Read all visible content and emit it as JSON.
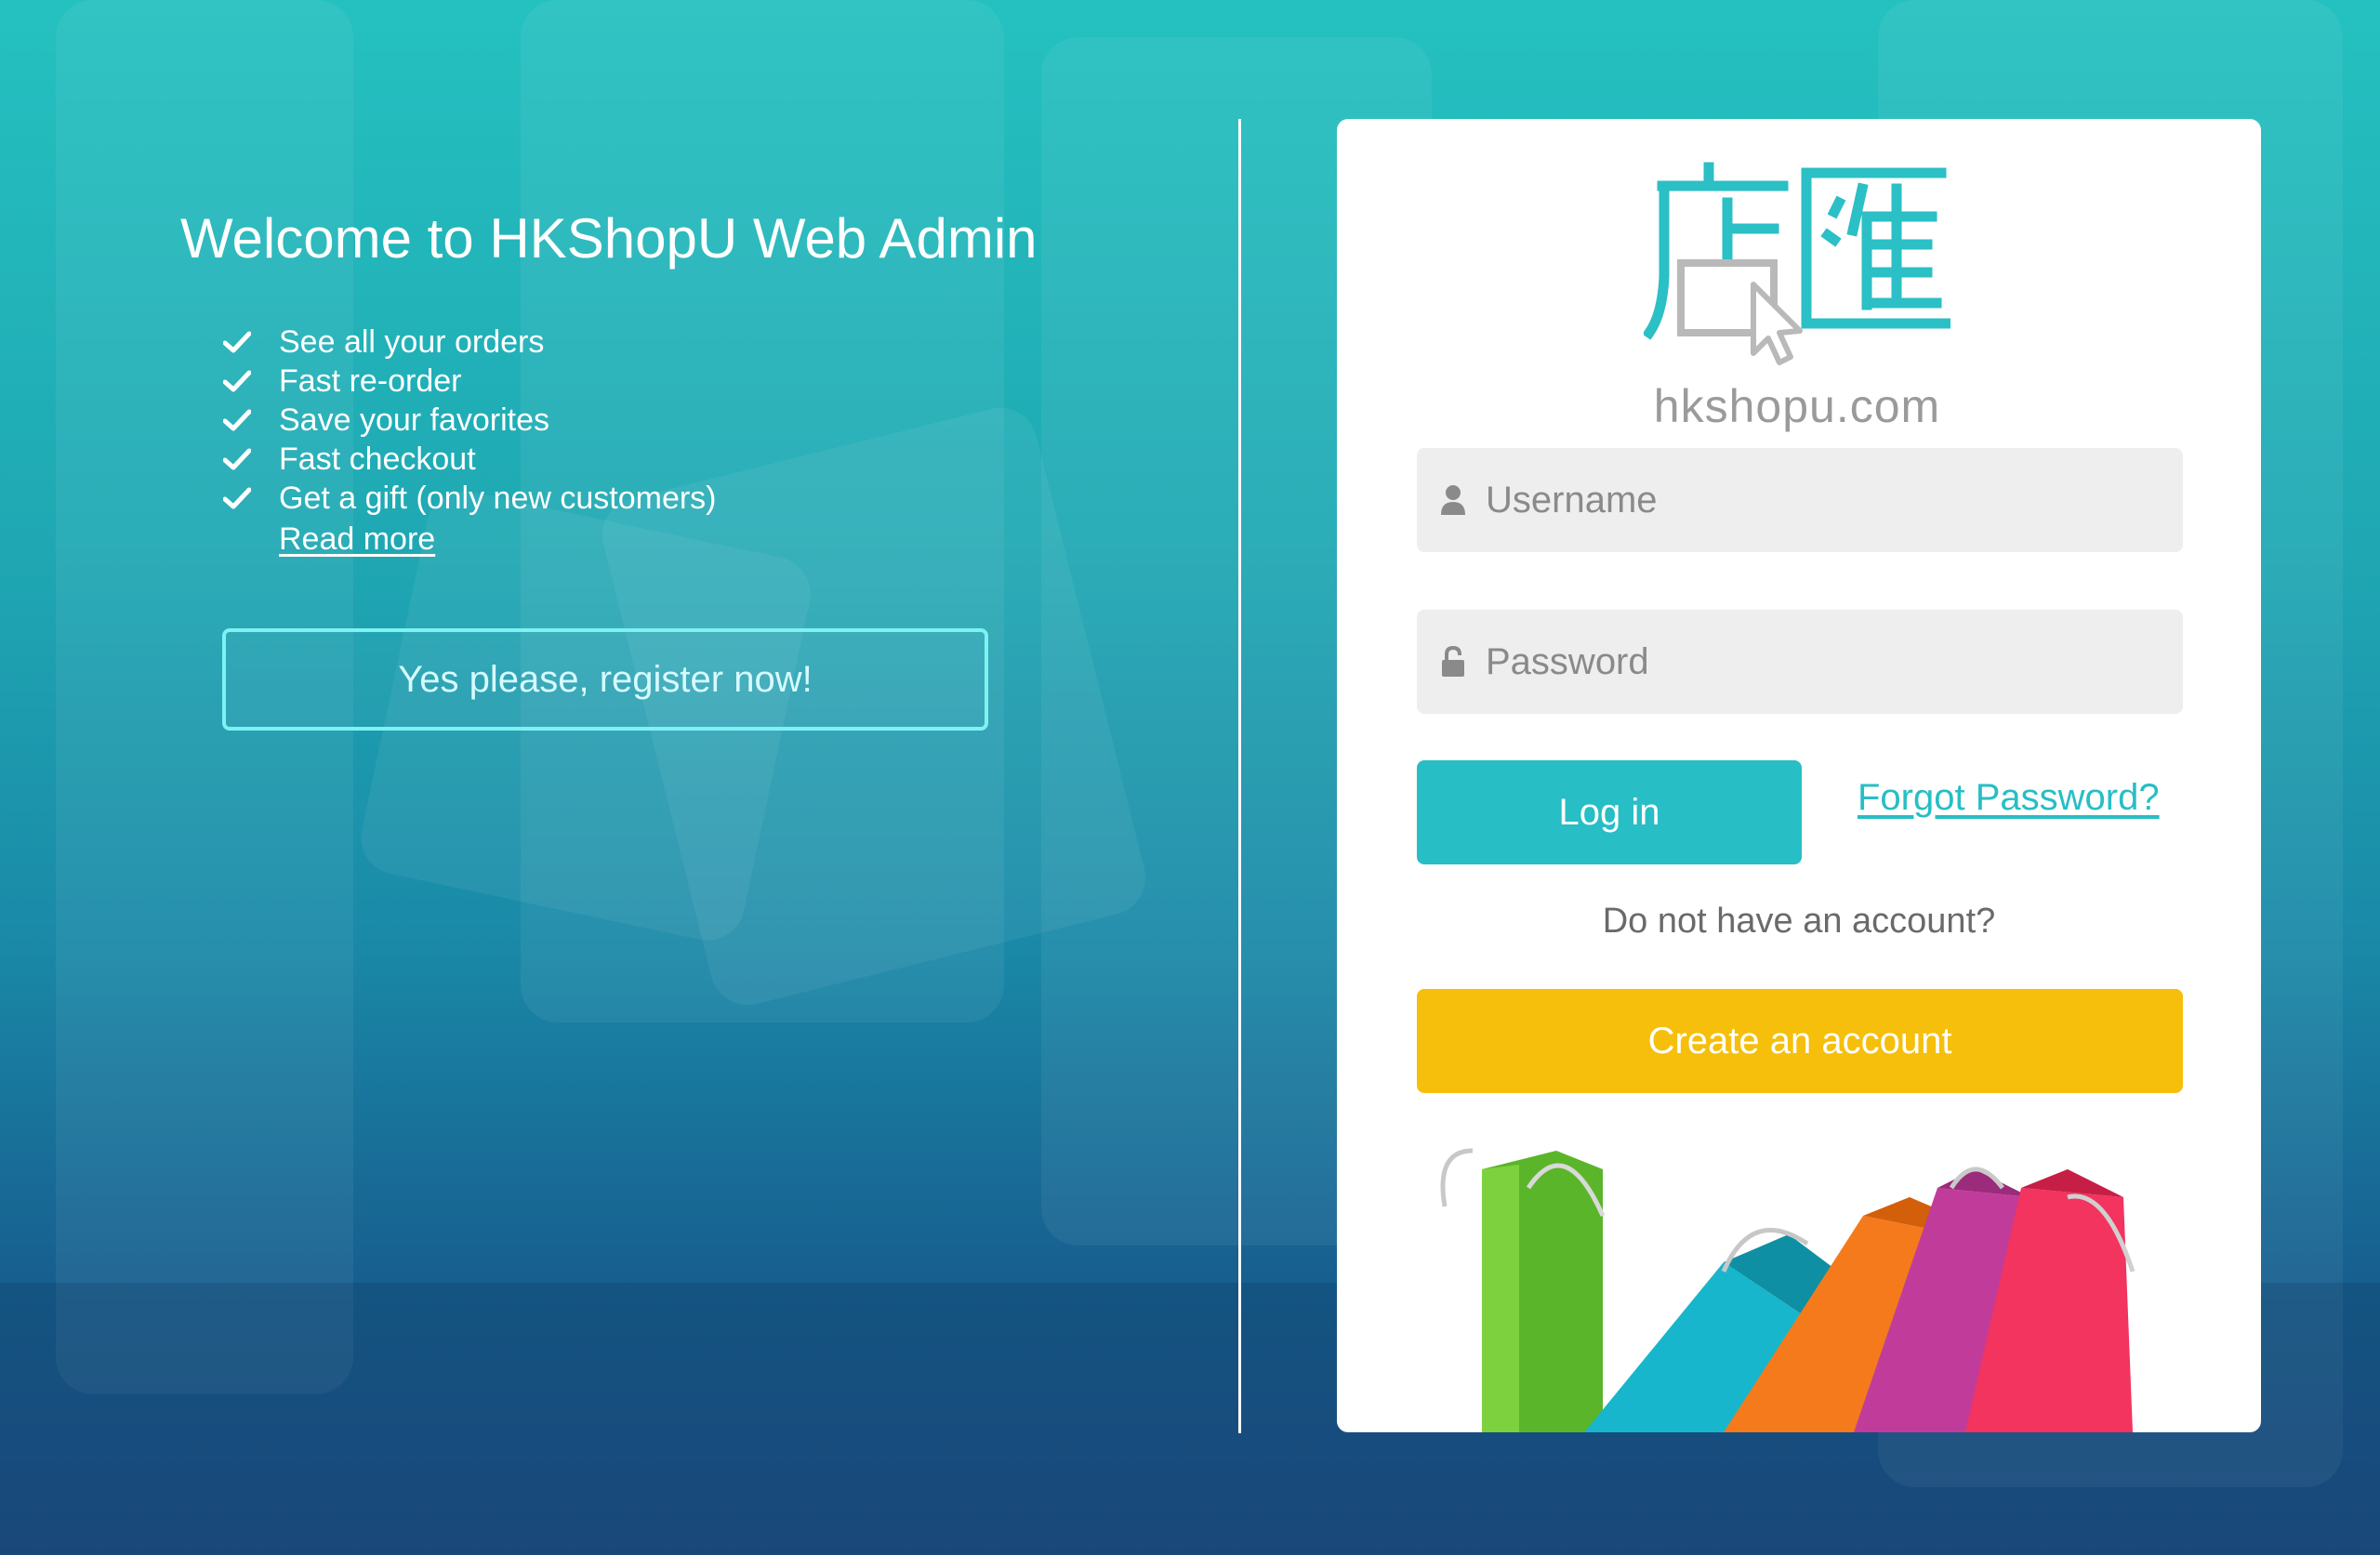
{
  "welcome": {
    "title": "Welcome to HKShopU Web Admin",
    "features": [
      "See all your orders",
      "Fast re-order",
      "Save your favorites",
      "Fast checkout",
      "Get a gift (only new customers)"
    ],
    "read_more": "Read more",
    "register_label": "Yes please, register now!"
  },
  "logo": {
    "chinese": "店滙",
    "domain": "hkshopu.com"
  },
  "login": {
    "username_placeholder": "Username",
    "password_placeholder": "Password",
    "login_label": "Log in",
    "forgot_label": "Forgot Password?",
    "no_account_text": "Do not have an account?",
    "create_label": "Create an account"
  },
  "colors": {
    "accent": "#27bec6",
    "create": "#f5bf0b",
    "register_border": "#7ef2f2"
  },
  "icons": {
    "feature": "check-icon",
    "username": "user-icon",
    "password": "lock-icon"
  }
}
